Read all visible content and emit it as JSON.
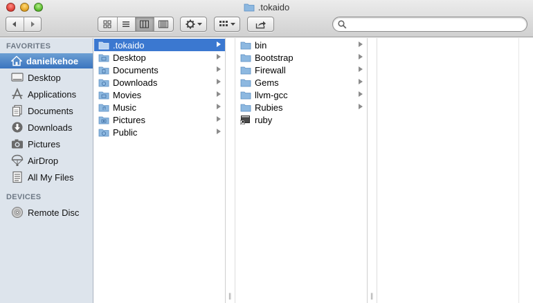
{
  "window": {
    "title": ".tokaido"
  },
  "toolbar": {
    "back_icon": "chevron-left-icon",
    "forward_icon": "chevron-right-icon",
    "view_modes": [
      "icon-view-icon",
      "list-view-icon",
      "column-view-icon",
      "coverflow-view-icon"
    ],
    "active_view": "column",
    "action_icon": "gear-icon",
    "arrange_icon": "arrange-icon",
    "share_icon": "share-icon",
    "search_placeholder": ""
  },
  "sidebar": {
    "favorites_header": "FAVORITES",
    "favorites": [
      {
        "label": "danielkehoe",
        "icon": "home-icon",
        "selected": true
      },
      {
        "label": "Desktop",
        "icon": "desktop-icon"
      },
      {
        "label": "Applications",
        "icon": "applications-icon"
      },
      {
        "label": "Documents",
        "icon": "documents-icon"
      },
      {
        "label": "Downloads",
        "icon": "downloads-icon"
      },
      {
        "label": "Pictures",
        "icon": "pictures-icon"
      },
      {
        "label": "AirDrop",
        "icon": "airdrop-icon"
      },
      {
        "label": "All My Files",
        "icon": "all-files-icon"
      }
    ],
    "devices_header": "DEVICES",
    "devices": [
      {
        "label": "Remote Disc",
        "icon": "disc-icon"
      }
    ]
  },
  "columns": {
    "col1": [
      {
        "label": ".tokaido",
        "selected": true,
        "folder": true
      },
      {
        "label": "Desktop",
        "folder": true
      },
      {
        "label": "Documents",
        "folder": true
      },
      {
        "label": "Downloads",
        "folder": true
      },
      {
        "label": "Movies",
        "folder": true
      },
      {
        "label": "Music",
        "folder": true
      },
      {
        "label": "Pictures",
        "folder": true
      },
      {
        "label": "Public",
        "folder": true
      }
    ],
    "col2": [
      {
        "label": "bin",
        "folder": true
      },
      {
        "label": "Bootstrap",
        "folder": true
      },
      {
        "label": "Firewall",
        "folder": true
      },
      {
        "label": "Gems",
        "folder": true
      },
      {
        "label": "llvm-gcc",
        "folder": true
      },
      {
        "label": "Rubies",
        "folder": true
      },
      {
        "label": "ruby",
        "folder": false
      }
    ]
  },
  "colors": {
    "sidebar_bg": "#dde4ec",
    "selection": "#3b78d0",
    "folder": "#8db8e0"
  }
}
